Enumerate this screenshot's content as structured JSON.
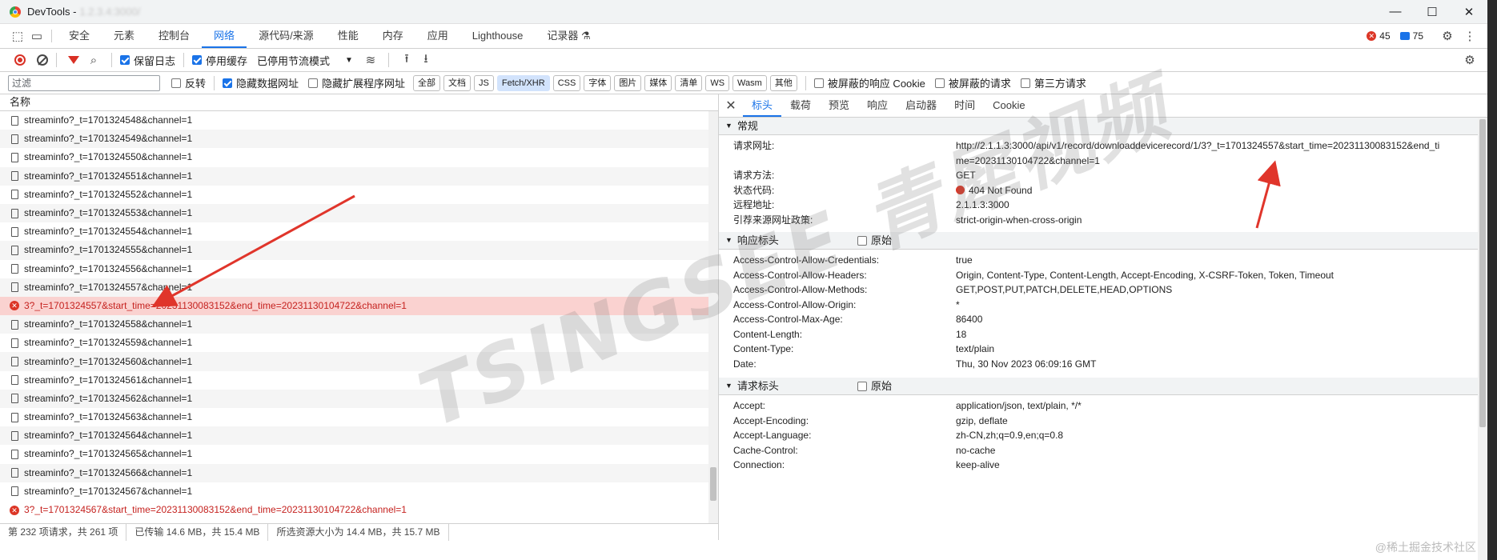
{
  "window": {
    "title": "DevTools - ",
    "title_faded": "1.2.3.4:3000/",
    "min": "—",
    "max": "☐",
    "close": "✕"
  },
  "tabs": [
    "安全",
    "元素",
    "控制台",
    "网络",
    "源代码/来源",
    "性能",
    "内存",
    "应用",
    "Lighthouse",
    "记录器 ⚗"
  ],
  "active_tab": "网络",
  "badges": {
    "errors": "45",
    "messages": "75"
  },
  "toolbar1": {
    "preserve_log": "保留日志",
    "disable_cache": "停用缓存",
    "throttle": "已停用节流模式"
  },
  "toolbar2": {
    "filter_placeholder": "过滤",
    "invert": "反转",
    "hide_data_urls": "隐藏数据网址",
    "hide_ext_urls": "隐藏扩展程序网址",
    "types": [
      "全部",
      "文档",
      "JS",
      "Fetch/XHR",
      "CSS",
      "字体",
      "图片",
      "媒体",
      "清单",
      "WS",
      "Wasm",
      "其他"
    ],
    "active_type": "Fetch/XHR",
    "blocked_cookies": "被屏蔽的响应 Cookie",
    "blocked_requests": "被屏蔽的请求",
    "third_party": "第三方请求"
  },
  "list": {
    "header": "名称",
    "rows": [
      {
        "name": "streaminfo?_t=1701324548&channel=1",
        "error": false
      },
      {
        "name": "streaminfo?_t=1701324549&channel=1",
        "error": false
      },
      {
        "name": "streaminfo?_t=1701324550&channel=1",
        "error": false
      },
      {
        "name": "streaminfo?_t=1701324551&channel=1",
        "error": false
      },
      {
        "name": "streaminfo?_t=1701324552&channel=1",
        "error": false
      },
      {
        "name": "streaminfo?_t=1701324553&channel=1",
        "error": false
      },
      {
        "name": "streaminfo?_t=1701324554&channel=1",
        "error": false
      },
      {
        "name": "streaminfo?_t=1701324555&channel=1",
        "error": false
      },
      {
        "name": "streaminfo?_t=1701324556&channel=1",
        "error": false
      },
      {
        "name": "streaminfo?_t=1701324557&channel=1",
        "error": false
      },
      {
        "name": "3?_t=1701324557&start_time=20231130083152&end_time=20231130104722&channel=1",
        "error": true
      },
      {
        "name": "streaminfo?_t=1701324558&channel=1",
        "error": false
      },
      {
        "name": "streaminfo?_t=1701324559&channel=1",
        "error": false
      },
      {
        "name": "streaminfo?_t=1701324560&channel=1",
        "error": false
      },
      {
        "name": "streaminfo?_t=1701324561&channel=1",
        "error": false
      },
      {
        "name": "streaminfo?_t=1701324562&channel=1",
        "error": false
      },
      {
        "name": "streaminfo?_t=1701324563&channel=1",
        "error": false
      },
      {
        "name": "streaminfo?_t=1701324564&channel=1",
        "error": false
      },
      {
        "name": "streaminfo?_t=1701324565&channel=1",
        "error": false
      },
      {
        "name": "streaminfo?_t=1701324566&channel=1",
        "error": false
      },
      {
        "name": "streaminfo?_t=1701324567&channel=1",
        "error": false
      },
      {
        "name": "3?_t=1701324567&start_time=20231130083152&end_time=20231130104722&channel=1",
        "error": true
      }
    ]
  },
  "status": {
    "requests": "第 232 项请求，共 261 项",
    "transferred": "已传输 14.6 MB，共 15.4 MB",
    "resources": "所选资源大小为 14.4 MB，共 15.7 MB"
  },
  "detail": {
    "tabs": [
      "标头",
      "载荷",
      "预览",
      "响应",
      "启动器",
      "时间",
      "Cookie"
    ],
    "active": "标头",
    "general": {
      "title": "常规",
      "rows": [
        {
          "k": "请求网址:",
          "v": "http://2.1.1.3:3000/api/v1/record/downloaddevicerecord/1/3?_t=1701324557&start_time=20231130083152&end_time=20231130104722&channel=1"
        },
        {
          "k": "请求方法:",
          "v": "GET"
        },
        {
          "k": "状态代码:",
          "v": "404 Not Found"
        },
        {
          "k": "远程地址:",
          "v": "2.1.1.3:3000"
        },
        {
          "k": "引荐来源网址政策:",
          "v": "strict-origin-when-cross-origin"
        }
      ]
    },
    "response": {
      "title": "响应标头",
      "raw": "原始",
      "rows": [
        {
          "k": "Access-Control-Allow-Credentials:",
          "v": "true"
        },
        {
          "k": "Access-Control-Allow-Headers:",
          "v": "Origin, Content-Type, Content-Length, Accept-Encoding, X-CSRF-Token, Token, Timeout"
        },
        {
          "k": "Access-Control-Allow-Methods:",
          "v": "GET,POST,PUT,PATCH,DELETE,HEAD,OPTIONS"
        },
        {
          "k": "Access-Control-Allow-Origin:",
          "v": "*"
        },
        {
          "k": "Access-Control-Max-Age:",
          "v": "86400"
        },
        {
          "k": "Content-Length:",
          "v": "18"
        },
        {
          "k": "Content-Type:",
          "v": "text/plain"
        },
        {
          "k": "Date:",
          "v": "Thu, 30 Nov 2023 06:09:16 GMT"
        }
      ]
    },
    "request": {
      "title": "请求标头",
      "raw": "原始",
      "rows": [
        {
          "k": "Accept:",
          "v": "application/json, text/plain, */*"
        },
        {
          "k": "Accept-Encoding:",
          "v": "gzip, deflate"
        },
        {
          "k": "Accept-Language:",
          "v": "zh-CN,zh;q=0.9,en;q=0.8"
        },
        {
          "k": "Cache-Control:",
          "v": "no-cache"
        },
        {
          "k": "Connection:",
          "v": "keep-alive"
        }
      ]
    }
  },
  "watermark": "TSINGSEE青犀视频",
  "corner_mark": "@稀土掘金技术社区",
  "colors": {
    "accent": "#1a73e8",
    "error": "#dc3626",
    "error_row": "#fad2d0",
    "arrow": "#e0352b"
  }
}
